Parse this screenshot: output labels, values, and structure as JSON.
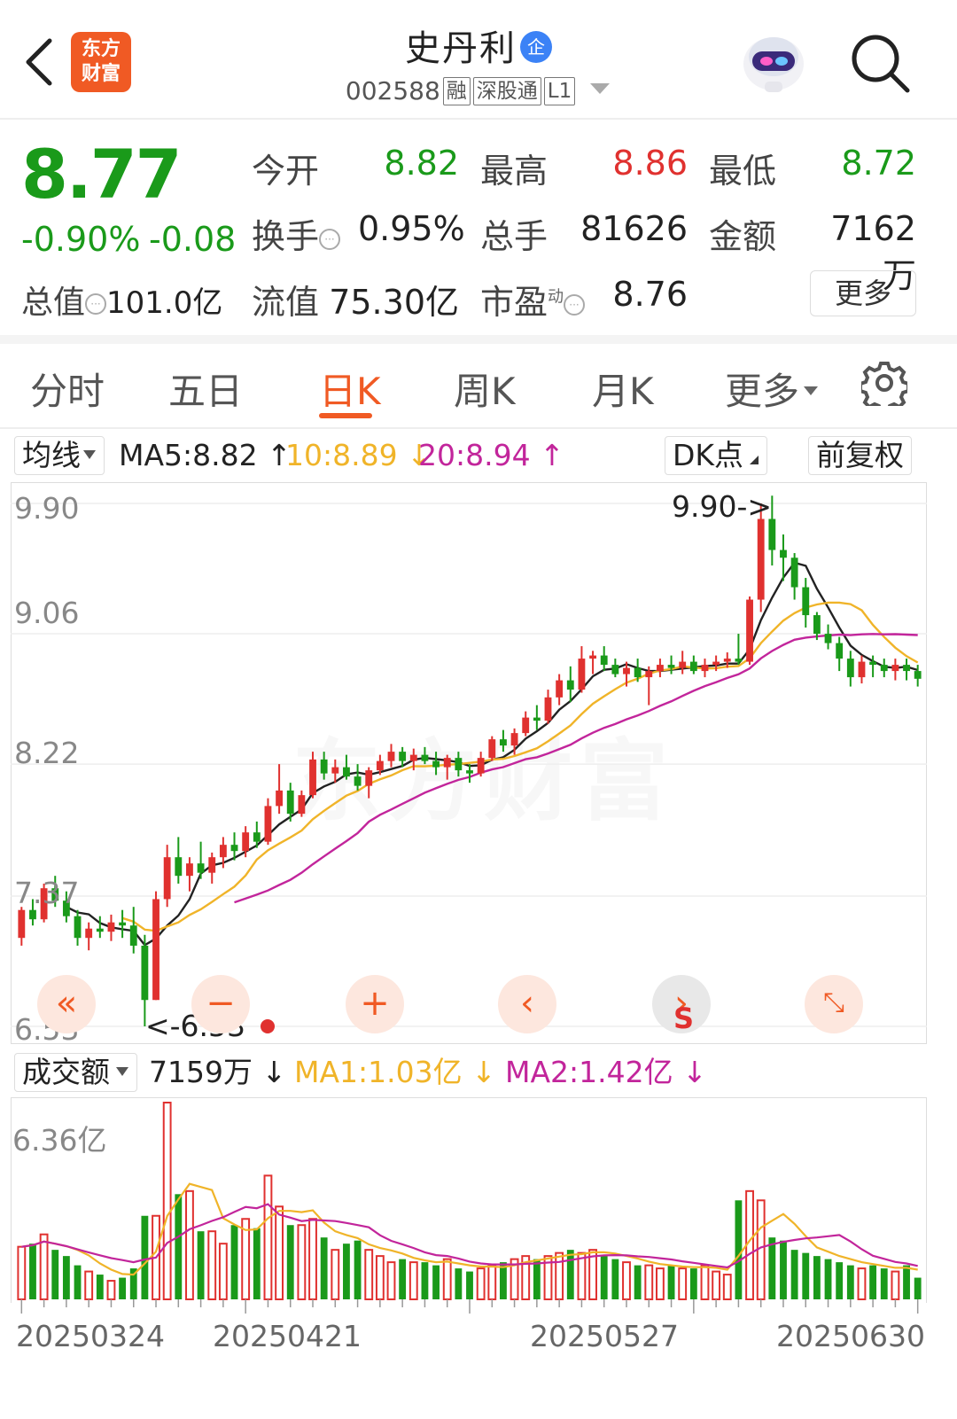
{
  "header": {
    "logo_text_1": "东方",
    "logo_text_2": "财富",
    "stock_name": "史丹利",
    "badge": "企",
    "code": "002588",
    "tags": [
      "融",
      "深股通",
      "L1"
    ]
  },
  "quote": {
    "price": "8.77",
    "pct_change": "-0.90%",
    "change": "-0.08",
    "total_value_label": "总值",
    "total_value": "101.0亿",
    "open_label": "今开",
    "open": "8.82",
    "high_label": "最高",
    "high": "8.86",
    "low_label": "最低",
    "low": "8.72",
    "turnover_label": "换手",
    "turnover": "0.95%",
    "volume_label": "总手",
    "volume": "81626",
    "amount_label": "金额",
    "amount": "7162万",
    "float_label": "流值",
    "float_value": "75.30亿",
    "pe_label": "市盈",
    "pe_sup": "动",
    "pe": "8.76",
    "more_button": "更多"
  },
  "tabs": [
    {
      "label": "分时",
      "active": false
    },
    {
      "label": "五日",
      "active": false
    },
    {
      "label": "日K",
      "active": true
    },
    {
      "label": "周K",
      "active": false
    },
    {
      "label": "月K",
      "active": false
    },
    {
      "label": "更多",
      "active": false
    }
  ],
  "ma_bar": {
    "selector": "均线",
    "ma5": "MA5:8.82",
    "ma10": "10:8.89",
    "ma20": "20:8.94",
    "dk_button": "DK点",
    "adjust_button": "前复权"
  },
  "volume_bar": {
    "selector": "成交额",
    "current": "7159万",
    "ma1": "MA1:1.03亿",
    "ma2": "MA2:1.42亿"
  },
  "colors": {
    "up": "#e0312f",
    "down": "#1a9a1a",
    "ma5": "#222222",
    "ma10": "#f0b429",
    "ma20": "#c2259b",
    "accent": "#f05a24"
  },
  "chart_data": {
    "type": "candlestick",
    "y_axis_labels": [
      "9.90",
      "9.06",
      "8.22",
      "7.37",
      "6.53"
    ],
    "ylim": [
      6.53,
      9.9
    ],
    "max_marker": "9.90->",
    "min_marker": "<-6.53",
    "x_labels": [
      "20250324",
      "20250421",
      "20250527",
      "20250630"
    ],
    "volume_axis_label": "6.36亿",
    "volume_max": 6.36,
    "candles": [
      [
        7.1,
        7.3,
        7.05,
        7.28
      ],
      [
        7.28,
        7.35,
        7.18,
        7.22
      ],
      [
        7.22,
        7.45,
        7.2,
        7.42
      ],
      [
        7.42,
        7.5,
        7.3,
        7.34
      ],
      [
        7.34,
        7.4,
        7.2,
        7.24
      ],
      [
        7.24,
        7.28,
        7.05,
        7.1
      ],
      [
        7.1,
        7.2,
        7.02,
        7.16
      ],
      [
        7.16,
        7.24,
        7.1,
        7.14
      ],
      [
        7.14,
        7.25,
        7.08,
        7.2
      ],
      [
        7.2,
        7.28,
        7.1,
        7.18
      ],
      [
        7.18,
        7.3,
        7.0,
        7.05
      ],
      [
        7.05,
        7.12,
        6.53,
        6.7
      ],
      [
        6.7,
        7.4,
        6.7,
        7.35
      ],
      [
        7.35,
        7.7,
        7.3,
        7.62
      ],
      [
        7.62,
        7.75,
        7.45,
        7.5
      ],
      [
        7.5,
        7.62,
        7.4,
        7.58
      ],
      [
        7.58,
        7.72,
        7.48,
        7.52
      ],
      [
        7.52,
        7.65,
        7.45,
        7.62
      ],
      [
        7.62,
        7.75,
        7.55,
        7.7
      ],
      [
        7.7,
        7.78,
        7.6,
        7.66
      ],
      [
        7.66,
        7.82,
        7.62,
        7.78
      ],
      [
        7.78,
        7.85,
        7.68,
        7.72
      ],
      [
        7.72,
        8.0,
        7.7,
        7.95
      ],
      [
        7.95,
        8.22,
        7.9,
        8.05
      ],
      [
        8.05,
        8.1,
        7.85,
        7.9
      ],
      [
        7.9,
        8.05,
        7.88,
        8.02
      ],
      [
        8.02,
        8.3,
        8.0,
        8.25
      ],
      [
        8.25,
        8.3,
        8.12,
        8.16
      ],
      [
        8.16,
        8.25,
        8.1,
        8.2
      ],
      [
        8.2,
        8.28,
        8.12,
        8.14
      ],
      [
        8.14,
        8.22,
        8.05,
        8.08
      ],
      [
        8.08,
        8.2,
        8.0,
        8.18
      ],
      [
        8.18,
        8.28,
        8.15,
        8.24
      ],
      [
        8.24,
        8.35,
        8.2,
        8.3
      ],
      [
        8.3,
        8.33,
        8.2,
        8.24
      ],
      [
        8.24,
        8.32,
        8.18,
        8.28
      ],
      [
        8.28,
        8.33,
        8.22,
        8.24
      ],
      [
        8.24,
        8.3,
        8.15,
        8.2
      ],
      [
        8.2,
        8.28,
        8.12,
        8.26
      ],
      [
        8.26,
        8.3,
        8.14,
        8.18
      ],
      [
        8.18,
        8.22,
        8.1,
        8.16
      ],
      [
        8.16,
        8.3,
        8.14,
        8.26
      ],
      [
        8.26,
        8.4,
        8.24,
        8.38
      ],
      [
        8.38,
        8.44,
        8.3,
        8.34
      ],
      [
        8.34,
        8.45,
        8.28,
        8.42
      ],
      [
        8.42,
        8.56,
        8.4,
        8.52
      ],
      [
        8.52,
        8.6,
        8.44,
        8.5
      ],
      [
        8.5,
        8.7,
        8.48,
        8.65
      ],
      [
        8.65,
        8.8,
        8.6,
        8.76
      ],
      [
        8.76,
        8.85,
        8.62,
        8.7
      ],
      [
        8.7,
        8.98,
        8.68,
        8.9
      ],
      [
        8.9,
        8.95,
        8.8,
        8.92
      ],
      [
        8.92,
        8.98,
        8.82,
        8.86
      ],
      [
        8.86,
        8.9,
        8.78,
        8.8
      ],
      [
        8.8,
        8.88,
        8.72,
        8.84
      ],
      [
        8.84,
        8.9,
        8.75,
        8.78
      ],
      [
        8.78,
        8.85,
        8.6,
        8.82
      ],
      [
        8.82,
        8.9,
        8.78,
        8.86
      ],
      [
        8.86,
        8.92,
        8.8,
        8.84
      ],
      [
        8.84,
        8.95,
        8.8,
        8.88
      ],
      [
        8.88,
        8.92,
        8.8,
        8.82
      ],
      [
        8.82,
        8.9,
        8.78,
        8.86
      ],
      [
        8.86,
        8.92,
        8.82,
        8.88
      ],
      [
        8.88,
        8.94,
        8.84,
        8.9
      ],
      [
        8.9,
        9.06,
        8.86,
        8.88
      ],
      [
        8.88,
        9.3,
        8.86,
        9.28
      ],
      [
        9.28,
        9.9,
        9.2,
        9.8
      ],
      [
        9.8,
        9.95,
        9.5,
        9.6
      ],
      [
        9.6,
        9.7,
        9.4,
        9.55
      ],
      [
        9.55,
        9.58,
        9.28,
        9.36
      ],
      [
        9.36,
        9.42,
        9.1,
        9.18
      ],
      [
        9.18,
        9.2,
        9.02,
        9.06
      ],
      [
        9.06,
        9.12,
        8.96,
        9.0
      ],
      [
        9.0,
        9.04,
        8.82,
        8.9
      ],
      [
        8.9,
        8.95,
        8.72,
        8.78
      ],
      [
        8.78,
        8.92,
        8.74,
        8.88
      ],
      [
        8.88,
        8.92,
        8.78,
        8.86
      ],
      [
        8.86,
        8.9,
        8.78,
        8.82
      ],
      [
        8.82,
        8.9,
        8.76,
        8.86
      ],
      [
        8.86,
        8.9,
        8.76,
        8.82
      ],
      [
        8.82,
        8.86,
        8.72,
        8.77
      ]
    ],
    "volumes": [
      1.7,
      1.8,
      2.1,
      1.6,
      1.4,
      1.1,
      0.9,
      0.8,
      0.6,
      0.7,
      1.0,
      2.7,
      2.7,
      6.36,
      3.4,
      3.5,
      2.2,
      2.2,
      1.8,
      2.4,
      2.6,
      2.3,
      4.0,
      3.0,
      2.4,
      2.4,
      2.6,
      2.0,
      1.6,
      1.8,
      1.9,
      1.6,
      1.4,
      1.2,
      1.3,
      1.2,
      1.2,
      1.1,
      1.3,
      1.0,
      0.9,
      1.0,
      1.1,
      1.2,
      1.3,
      1.4,
      1.3,
      1.4,
      1.5,
      1.6,
      1.5,
      1.6,
      1.4,
      1.3,
      1.2,
      1.1,
      1.1,
      1.0,
      1.1,
      1.0,
      1.0,
      1.1,
      0.9,
      0.8,
      3.2,
      3.5,
      3.2,
      2.0,
      1.9,
      1.6,
      1.5,
      1.4,
      1.3,
      1.2,
      1.1,
      1.0,
      1.1,
      1.0,
      0.9,
      1.1,
      0.7
    ]
  }
}
